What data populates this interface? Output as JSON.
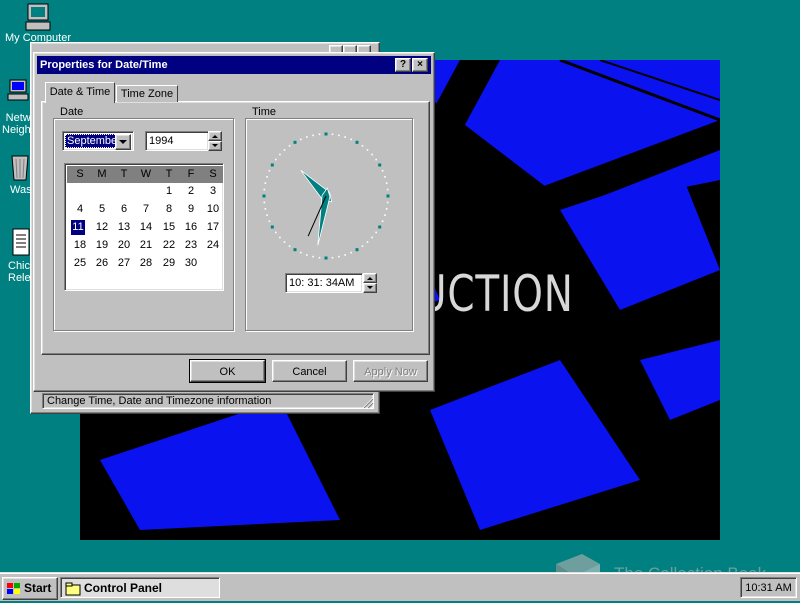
{
  "desktop": {
    "icons": [
      {
        "label": "My Computer",
        "icon": "computer-icon"
      },
      {
        "label": "Network Neighborhood",
        "icon": "network-icon"
      },
      {
        "label": "Wastebasket",
        "icon": "recycle-bin-icon"
      },
      {
        "label": "Chicago Release Notes",
        "icon": "notepad-icon"
      }
    ],
    "wallpaper_text": "UCTION"
  },
  "control_panel": {
    "status_text": "Change Time, Date and Timezone information"
  },
  "dialog": {
    "title": "Properties for Date/Time",
    "help_button": "?",
    "close_button": "×",
    "tabs": [
      {
        "label": "Date & Time",
        "active": true
      },
      {
        "label": "Time Zone",
        "active": false
      }
    ],
    "date_group_label": "Date",
    "time_group_label": "Time",
    "month": "September",
    "year": "1994",
    "weekdays": [
      "S",
      "M",
      "T",
      "W",
      "T",
      "F",
      "S"
    ],
    "days": [
      "1",
      "2",
      "3",
      "4",
      "5",
      "6",
      "7",
      "8",
      "9",
      "10",
      "11",
      "12",
      "13",
      "14",
      "15",
      "16",
      "17",
      "18",
      "19",
      "20",
      "21",
      "22",
      "23",
      "24",
      "25",
      "26",
      "27",
      "28",
      "29",
      "30"
    ],
    "first_weekday_index": 4,
    "selected_day": "11",
    "time_value": "10: 31: 34AM",
    "clock": {
      "hour": 10,
      "minute": 31,
      "second": 34
    },
    "ok_label": "OK",
    "cancel_label": "Cancel",
    "apply_label": "Apply Now"
  },
  "taskbar": {
    "start_label": "Start",
    "task_label": "Control Panel",
    "clock_text": "10:31 AM"
  },
  "watermark": {
    "text": "The Collection Book"
  },
  "colors": {
    "desktop": "#008080",
    "titlebar": "#000080",
    "wallpaper_blue": "#0a12f0",
    "face": "#c0c0c0"
  }
}
